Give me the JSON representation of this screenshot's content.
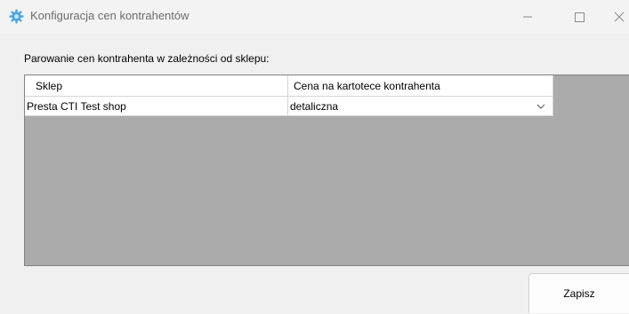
{
  "window": {
    "title": "Konfiguracja cen kontrahentów",
    "icon": "gear-app-icon",
    "controls": [
      "minimize-icon",
      "maximize-icon",
      "close-icon"
    ]
  },
  "main": {
    "section_label": "Parowanie cen kontrahenta w zależności od sklepu:",
    "grid": {
      "columns": [
        "Sklep",
        "Cena na kartotece kontrahenta"
      ],
      "rows": [
        {
          "sklep": "Presta CTI Test shop",
          "cena": "detaliczna"
        }
      ]
    },
    "save_label": "Zapisz"
  },
  "colors": {
    "grid_background": "#ababab",
    "app_icon": "#4aa3df"
  }
}
